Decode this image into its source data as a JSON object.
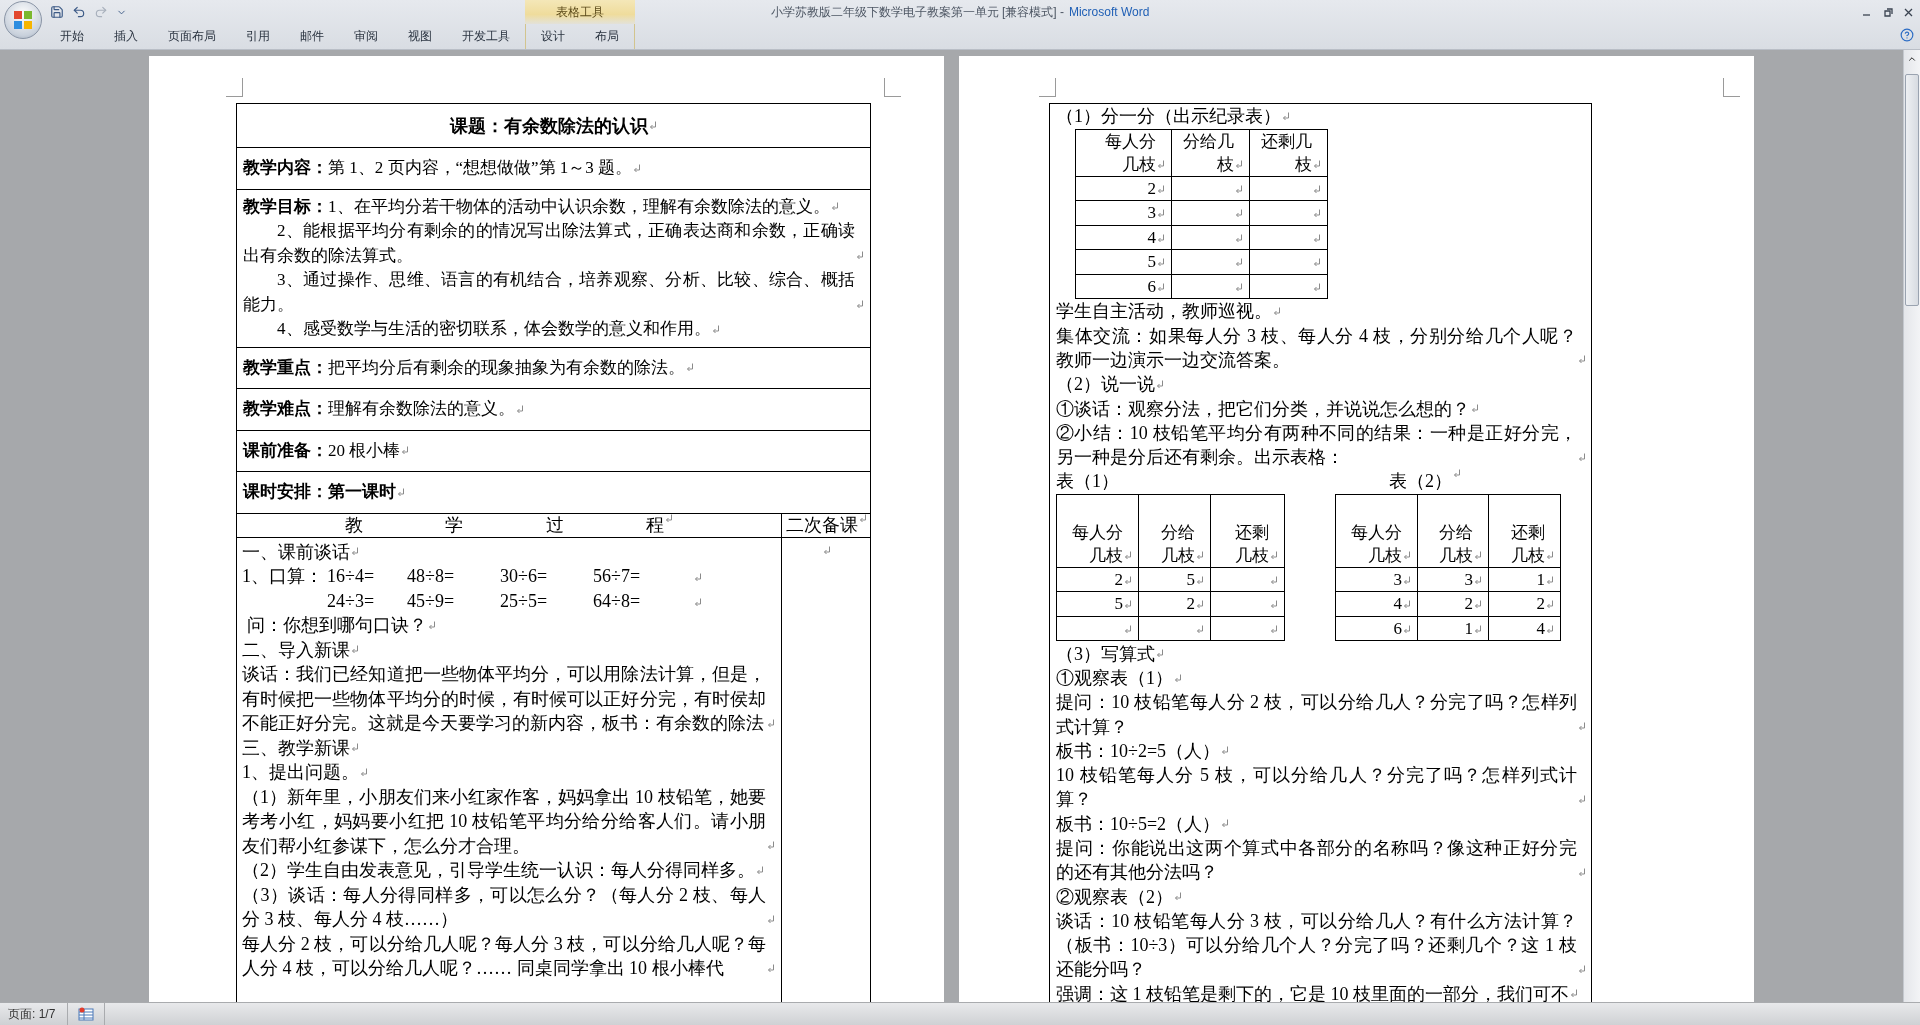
{
  "window": {
    "title": "小学苏教版二年级下数学电子教案第一单元 [兼容模式] -",
    "app_name": "Microsoft Word"
  },
  "ribbon": {
    "context_group": "表格工具",
    "tabs": [
      {
        "label": "开始",
        "contextual": false
      },
      {
        "label": "插入",
        "contextual": false
      },
      {
        "label": "页面布局",
        "contextual": false
      },
      {
        "label": "引用",
        "contextual": false
      },
      {
        "label": "邮件",
        "contextual": false
      },
      {
        "label": "审阅",
        "contextual": false
      },
      {
        "label": "视图",
        "contextual": false
      },
      {
        "label": "开发工具",
        "contextual": false
      },
      {
        "label": "设计",
        "contextual": true
      },
      {
        "label": "布局",
        "contextual": true
      }
    ]
  },
  "show_formatting_marks": true,
  "left_page": {
    "title": "课题：有余数除法的认识",
    "info_rows": [
      {
        "label": "教学内容：",
        "bold_value": false,
        "paragraphs": [
          "第 1、2 页内容，“想想做做”第 1～3 题。"
        ]
      },
      {
        "label": "教学目标：",
        "bold_value": false,
        "paragraphs": [
          "1、在平均分若干物体的活动中认识余数，理解有余数除法的意义。",
          "2、能根据平均分有剩余的的情况写出除法算式，正确表达商和余数，正确读出有余数的除法算式。",
          "3、通过操作、思维、语言的有机结合，培养观察、分析、比较、综合、概括能力。",
          "4、感受数学与生活的密切联系，体会数学的意义和作用。"
        ]
      },
      {
        "label": "教学重点：",
        "bold_value": false,
        "paragraphs": [
          "把平均分后有剩余的现象抽象为有余数的除法。"
        ]
      },
      {
        "label": "教学难点：",
        "bold_value": false,
        "paragraphs": [
          "理解有余数除法的意义。"
        ]
      },
      {
        "label": "课前准备：",
        "bold_value": false,
        "paragraphs": [
          "20 根小棒"
        ]
      },
      {
        "label": "课时安排：",
        "bold_value": true,
        "paragraphs": [
          "第一课时"
        ]
      }
    ],
    "process_heading": "教 学 过 程",
    "notes_heading": "二次备课",
    "process": [
      {
        "kind": "text",
        "text": "一、课前谈话"
      },
      {
        "kind": "drill",
        "lead": "1、口算：",
        "rows": [
          [
            "16÷4=",
            "48÷8=",
            "30÷6=",
            "56÷7="
          ],
          [
            "24÷3=",
            "45÷9=",
            "25÷5=",
            "64÷8="
          ]
        ]
      },
      {
        "kind": "text",
        "text": " 问：你想到哪句口诀？"
      },
      {
        "kind": "text",
        "text": "二、导入新课"
      },
      {
        "kind": "text",
        "text": "谈话：我们已经知道把一些物体平均分，可以用除法计算，但是，有时候把一些物体平均分的时候，有时候可以正好分完，有时侯却不能正好分完。这就是今天要学习的新内容，板书：有余数的除法"
      },
      {
        "kind": "text",
        "text": "三、教学新课"
      },
      {
        "kind": "text",
        "text": "1、提出问题。"
      },
      {
        "kind": "text",
        "text": "（1）新年里，小朋友们来小红家作客，妈妈拿出 10 枝铅笔，她要考考小红，妈妈要小红把 10 枝铅笔平均分给分给客人们。请小朋友们帮小红参谋下，怎么分才合理。"
      },
      {
        "kind": "text",
        "text": "（2）学生自由发表意见，引导学生统一认识：每人分得同样多。"
      },
      {
        "kind": "text",
        "text": "（3）谈话：每人分得同样多，可以怎么分？（每人分 2 枝、每人分 3 枝、每人分 4 枝……）"
      },
      {
        "kind": "text",
        "text": "每人分 2 枝，可以分给几人呢？每人分 3 枝，可以分给几人呢？每人分 4 枝，可以分给几人呢？…… 同桌同学拿出 10 根小棒代"
      }
    ]
  },
  "right_page": {
    "content": [
      {
        "kind": "text",
        "text": "（1）分一分（出示纪录表）"
      },
      {
        "kind": "table",
        "columns": [
          "每人分几枝",
          "分给几枝",
          "还剩几枝"
        ],
        "rows": [
          {
            "cells": [
              "2"
            ]
          },
          {
            "cells": [
              "3"
            ]
          },
          {
            "cells": [
              "4"
            ]
          },
          {
            "cells": [
              "5"
            ]
          },
          {
            "cells": [
              "6"
            ]
          }
        ]
      },
      {
        "kind": "text",
        "text": "学生自主活动，教师巡视。"
      },
      {
        "kind": "text",
        "text": "集体交流：如果每人分 3 枝、每人分 4 枝，分别分给几个人呢？教师一边演示一边交流答案。"
      },
      {
        "kind": "text",
        "text": "（2）说一说"
      },
      {
        "kind": "text",
        "text": "①谈话：观察分法，把它们分类，并说说怎么想的？"
      },
      {
        "kind": "text",
        "text": "②小结：10 枝铅笔平均分有两种不同的结果：一种是正好分完，另一种是分后还有剩余。出示表格："
      },
      {
        "kind": "table_pair",
        "tables": [
          {
            "caption": "表（1）",
            "columns": [
              "每人分几枝",
              "分给几枝",
              "还剩几枝"
            ],
            "rows": [
              {
                "cells": [
                  "2",
                  "5"
                ]
              },
              {
                "cells": [
                  "5",
                  "2"
                ]
              },
              {
                "cells": []
              }
            ]
          },
          {
            "caption": "表（2）",
            "columns": [
              "每人分几枝",
              "分给几枝",
              "还剩几枝"
            ],
            "rows": [
              {
                "cells": [
                  "3",
                  "3",
                  "1"
                ]
              },
              {
                "cells": [
                  "4",
                  "2",
                  "2"
                ]
              },
              {
                "cells": [
                  "6",
                  "1",
                  "4"
                ]
              }
            ]
          }
        ]
      },
      {
        "kind": "text",
        "text": "（3）写算式"
      },
      {
        "kind": "text",
        "text": "①观察表（1）"
      },
      {
        "kind": "text",
        "text": "提问：10 枝铅笔每人分 2 枝，可以分给几人？分完了吗？怎样列式计算？"
      },
      {
        "kind": "text",
        "text": "板书：10÷2=5（人）"
      },
      {
        "kind": "text",
        "text": "10 枝铅笔每人分 5 枝，可以分给几人？分完了吗？怎样列式计算？"
      },
      {
        "kind": "text",
        "text": "板书：10÷5=2（人）"
      },
      {
        "kind": "text",
        "text": "提问：你能说出这两个算式中各部分的名称吗？像这种正好分完的还有其他分法吗？"
      },
      {
        "kind": "text",
        "text": "②观察表（2）"
      },
      {
        "kind": "text",
        "text": "谈话：10 枝铅笔每人分 3 枝，可以分给几人？有什么方法计算？（板书：10÷3）可以分给几个人？分完了吗？还剩几个？这 1 枝还能分吗？"
      },
      {
        "kind": "text",
        "text": "强调：这 1 枝铅笔是剩下的，它是 10 枝里面的一部分，我们可不"
      }
    ]
  },
  "status_bar": {
    "page": "页面: 1/7"
  }
}
